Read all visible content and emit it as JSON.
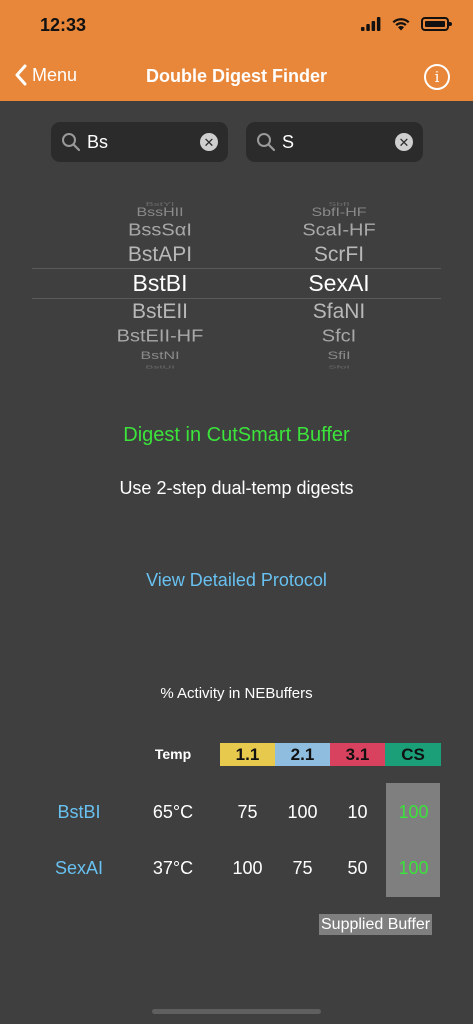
{
  "status_bar": {
    "time": "12:33"
  },
  "nav": {
    "back_label": "Menu",
    "title": "Double Digest Finder"
  },
  "search": {
    "left_value": "Bs",
    "right_value": "S"
  },
  "picker": {
    "left": [
      "BstYI",
      "BssHII",
      "BssSαI",
      "BstAPI",
      "BstBI",
      "BstEII",
      "BstEII-HF",
      "BstNI",
      "BstUI"
    ],
    "right": [
      "SbfI",
      "SbfI-HF",
      "ScaI-HF",
      "ScrFI",
      "SexAI",
      "SfaNI",
      "SfcI",
      "SfiI",
      "SfoI"
    ]
  },
  "result": {
    "buffer_text": "Digest in CutSmart Buffer",
    "note": "Use 2-step dual-temp digests",
    "protocol_link": "View Detailed Protocol"
  },
  "activity": {
    "title": "% Activity in NEBuffers",
    "temp_header": "Temp",
    "buffers": [
      "1.1",
      "2.1",
      "3.1",
      "CS"
    ],
    "rows": [
      {
        "enzyme": "BstBI",
        "temp": "65°C",
        "values": [
          "75",
          "100",
          "10",
          "100"
        ]
      },
      {
        "enzyme": "SexAI",
        "temp": "37°C",
        "values": [
          "100",
          "75",
          "50",
          "100"
        ]
      }
    ],
    "supplied_label": "Supplied Buffer"
  },
  "colors": {
    "header": "#e8873a",
    "background": "#3f3f3f",
    "buffer_1_1": "#e7c94e",
    "buffer_2_1": "#8fbde0",
    "buffer_3_1": "#d9425f",
    "buffer_cs": "#1a9f78",
    "positive": "#3be33b",
    "link": "#68c1f0"
  }
}
